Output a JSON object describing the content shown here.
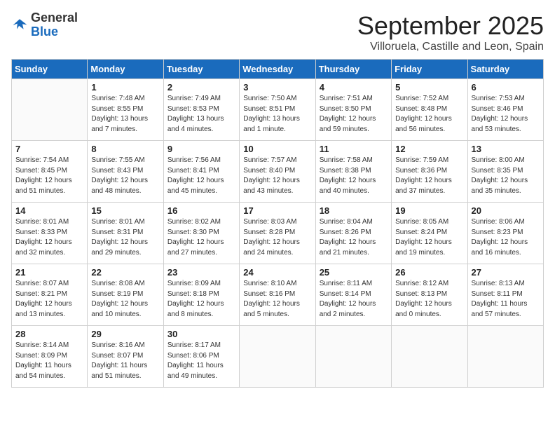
{
  "header": {
    "logo_general": "General",
    "logo_blue": "Blue",
    "month_title": "September 2025",
    "subtitle": "Villoruela, Castille and Leon, Spain"
  },
  "weekdays": [
    "Sunday",
    "Monday",
    "Tuesday",
    "Wednesday",
    "Thursday",
    "Friday",
    "Saturday"
  ],
  "weeks": [
    [
      {
        "day": "",
        "info": ""
      },
      {
        "day": "1",
        "info": "Sunrise: 7:48 AM\nSunset: 8:55 PM\nDaylight: 13 hours\nand 7 minutes."
      },
      {
        "day": "2",
        "info": "Sunrise: 7:49 AM\nSunset: 8:53 PM\nDaylight: 13 hours\nand 4 minutes."
      },
      {
        "day": "3",
        "info": "Sunrise: 7:50 AM\nSunset: 8:51 PM\nDaylight: 13 hours\nand 1 minute."
      },
      {
        "day": "4",
        "info": "Sunrise: 7:51 AM\nSunset: 8:50 PM\nDaylight: 12 hours\nand 59 minutes."
      },
      {
        "day": "5",
        "info": "Sunrise: 7:52 AM\nSunset: 8:48 PM\nDaylight: 12 hours\nand 56 minutes."
      },
      {
        "day": "6",
        "info": "Sunrise: 7:53 AM\nSunset: 8:46 PM\nDaylight: 12 hours\nand 53 minutes."
      }
    ],
    [
      {
        "day": "7",
        "info": "Sunrise: 7:54 AM\nSunset: 8:45 PM\nDaylight: 12 hours\nand 51 minutes."
      },
      {
        "day": "8",
        "info": "Sunrise: 7:55 AM\nSunset: 8:43 PM\nDaylight: 12 hours\nand 48 minutes."
      },
      {
        "day": "9",
        "info": "Sunrise: 7:56 AM\nSunset: 8:41 PM\nDaylight: 12 hours\nand 45 minutes."
      },
      {
        "day": "10",
        "info": "Sunrise: 7:57 AM\nSunset: 8:40 PM\nDaylight: 12 hours\nand 43 minutes."
      },
      {
        "day": "11",
        "info": "Sunrise: 7:58 AM\nSunset: 8:38 PM\nDaylight: 12 hours\nand 40 minutes."
      },
      {
        "day": "12",
        "info": "Sunrise: 7:59 AM\nSunset: 8:36 PM\nDaylight: 12 hours\nand 37 minutes."
      },
      {
        "day": "13",
        "info": "Sunrise: 8:00 AM\nSunset: 8:35 PM\nDaylight: 12 hours\nand 35 minutes."
      }
    ],
    [
      {
        "day": "14",
        "info": "Sunrise: 8:01 AM\nSunset: 8:33 PM\nDaylight: 12 hours\nand 32 minutes."
      },
      {
        "day": "15",
        "info": "Sunrise: 8:01 AM\nSunset: 8:31 PM\nDaylight: 12 hours\nand 29 minutes."
      },
      {
        "day": "16",
        "info": "Sunrise: 8:02 AM\nSunset: 8:30 PM\nDaylight: 12 hours\nand 27 minutes."
      },
      {
        "day": "17",
        "info": "Sunrise: 8:03 AM\nSunset: 8:28 PM\nDaylight: 12 hours\nand 24 minutes."
      },
      {
        "day": "18",
        "info": "Sunrise: 8:04 AM\nSunset: 8:26 PM\nDaylight: 12 hours\nand 21 minutes."
      },
      {
        "day": "19",
        "info": "Sunrise: 8:05 AM\nSunset: 8:24 PM\nDaylight: 12 hours\nand 19 minutes."
      },
      {
        "day": "20",
        "info": "Sunrise: 8:06 AM\nSunset: 8:23 PM\nDaylight: 12 hours\nand 16 minutes."
      }
    ],
    [
      {
        "day": "21",
        "info": "Sunrise: 8:07 AM\nSunset: 8:21 PM\nDaylight: 12 hours\nand 13 minutes."
      },
      {
        "day": "22",
        "info": "Sunrise: 8:08 AM\nSunset: 8:19 PM\nDaylight: 12 hours\nand 10 minutes."
      },
      {
        "day": "23",
        "info": "Sunrise: 8:09 AM\nSunset: 8:18 PM\nDaylight: 12 hours\nand 8 minutes."
      },
      {
        "day": "24",
        "info": "Sunrise: 8:10 AM\nSunset: 8:16 PM\nDaylight: 12 hours\nand 5 minutes."
      },
      {
        "day": "25",
        "info": "Sunrise: 8:11 AM\nSunset: 8:14 PM\nDaylight: 12 hours\nand 2 minutes."
      },
      {
        "day": "26",
        "info": "Sunrise: 8:12 AM\nSunset: 8:13 PM\nDaylight: 12 hours\nand 0 minutes."
      },
      {
        "day": "27",
        "info": "Sunrise: 8:13 AM\nSunset: 8:11 PM\nDaylight: 11 hours\nand 57 minutes."
      }
    ],
    [
      {
        "day": "28",
        "info": "Sunrise: 8:14 AM\nSunset: 8:09 PM\nDaylight: 11 hours\nand 54 minutes."
      },
      {
        "day": "29",
        "info": "Sunrise: 8:16 AM\nSunset: 8:07 PM\nDaylight: 11 hours\nand 51 minutes."
      },
      {
        "day": "30",
        "info": "Sunrise: 8:17 AM\nSunset: 8:06 PM\nDaylight: 11 hours\nand 49 minutes."
      },
      {
        "day": "",
        "info": ""
      },
      {
        "day": "",
        "info": ""
      },
      {
        "day": "",
        "info": ""
      },
      {
        "day": "",
        "info": ""
      }
    ]
  ]
}
